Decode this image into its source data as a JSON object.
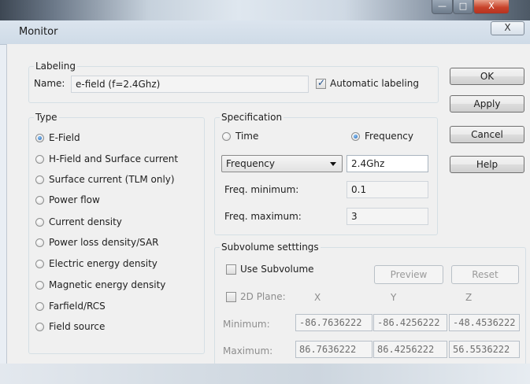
{
  "window": {
    "title": "Monitor",
    "min_glyph": "—",
    "max_glyph": "□",
    "close_glyph": "X"
  },
  "labeling": {
    "legend": "Labeling",
    "name_label": "Name:",
    "name_value": "e-field (f=2.4Ghz)",
    "auto_label": "Automatic labeling",
    "auto_checked": true
  },
  "type": {
    "legend": "Type",
    "options": [
      {
        "label": "E-Field",
        "selected": true
      },
      {
        "label": "H-Field and Surface current",
        "selected": false
      },
      {
        "label": "Surface current (TLM only)",
        "selected": false
      },
      {
        "label": "Power flow",
        "selected": false
      },
      {
        "label": "Current density",
        "selected": false
      },
      {
        "label": "Power loss density/SAR",
        "selected": false
      },
      {
        "label": "Electric energy density",
        "selected": false
      },
      {
        "label": "Magnetic energy density",
        "selected": false
      },
      {
        "label": "Farfield/RCS",
        "selected": false
      },
      {
        "label": "Field source",
        "selected": false
      }
    ]
  },
  "specification": {
    "legend": "Specification",
    "time_label": "Time",
    "frequency_label": "Frequency",
    "selected": "Frequency",
    "dropdown_value": "Frequency",
    "value": "2.4Ghz",
    "freq_min_label": "Freq. minimum:",
    "freq_min_value": "0.1",
    "freq_max_label": "Freq. maximum:",
    "freq_max_value": "3"
  },
  "subvolume": {
    "legend": "Subvolume setttings",
    "use_label": "Use Subvolume",
    "use_checked": false,
    "preview_label": "Preview",
    "reset_label": "Reset",
    "plane_label": "2D Plane:",
    "plane_checked": false,
    "axis_x": "X",
    "axis_y": "Y",
    "axis_z": "Z",
    "minimum_label": "Minimum:",
    "maximum_label": "Maximum:",
    "min_x": "-86.7636222",
    "min_y": "-86.4256222",
    "min_z": "-48.4536222",
    "max_x": "86.7636222",
    "max_y": "86.4256222",
    "max_z": "56.5536222"
  },
  "buttons": {
    "ok": "OK",
    "apply": "Apply",
    "cancel": "Cancel",
    "help": "Help"
  }
}
